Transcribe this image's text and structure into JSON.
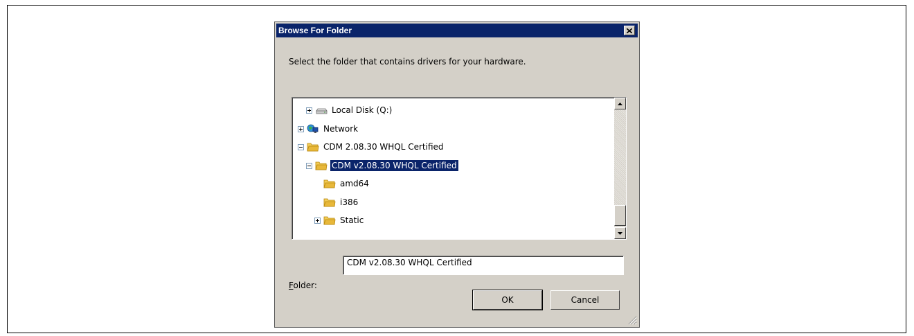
{
  "dialog": {
    "title": "Browse For Folder",
    "prompt": "Select the folder that contains drivers for your hardware.",
    "tree": [
      {
        "label": "Local Disk (Q:)",
        "expander": "plus",
        "icon": "drive-icon",
        "level": 1,
        "selected": false
      },
      {
        "label": "Network",
        "expander": "plus",
        "icon": "network-icon",
        "level": 0,
        "selected": false
      },
      {
        "label": "CDM 2.08.30 WHQL Certified",
        "expander": "minus",
        "icon": "folder-icon",
        "level": 0,
        "selected": false
      },
      {
        "label": "CDM v2.08.30 WHQL Certified",
        "expander": "minus",
        "icon": "folder-icon",
        "level": 1,
        "selected": true
      },
      {
        "label": "amd64",
        "expander": "none",
        "icon": "folder-icon",
        "level": 2,
        "selected": false
      },
      {
        "label": "i386",
        "expander": "none",
        "icon": "folder-icon",
        "level": 2,
        "selected": false
      },
      {
        "label": "Static",
        "expander": "plus",
        "icon": "folder-icon",
        "level": 2,
        "selected": false
      }
    ],
    "folder_label_accel": "F",
    "folder_label_rest": "older:",
    "folder_value": "CDM v2.08.30 WHQL Certified",
    "ok_label": "OK",
    "cancel_label": "Cancel",
    "close_glyph": "✕"
  },
  "colors": {
    "titlebar": "#0a246a",
    "dialog_bg": "#d4d0c8",
    "selection": "#0a246a",
    "folder": "#e8b83a"
  }
}
